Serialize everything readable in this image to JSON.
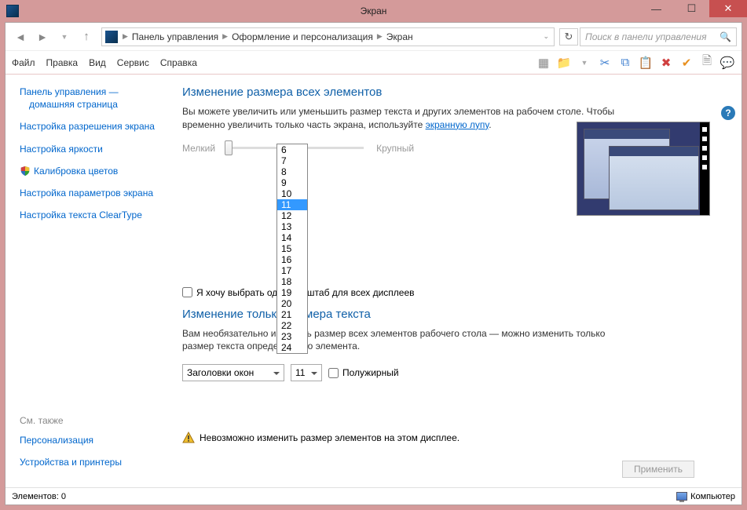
{
  "window": {
    "title": "Экран"
  },
  "breadcrumb": {
    "items": [
      "Панель управления",
      "Оформление и персонализация",
      "Экран"
    ]
  },
  "search": {
    "placeholder": "Поиск в панели управления"
  },
  "menu": {
    "items": [
      "Файл",
      "Правка",
      "Вид",
      "Сервис",
      "Справка"
    ]
  },
  "sidebar": {
    "links": [
      "Панель управления — домашняя страница",
      "Настройка разрешения экрана",
      "Настройка яркости",
      "Калибровка цветов",
      "Настройка параметров экрана",
      "Настройка текста ClearType"
    ],
    "see_also_heading": "См. также",
    "see_also": [
      "Персонализация",
      "Устройства и принтеры"
    ]
  },
  "main": {
    "heading1": "Изменение размера всех элементов",
    "desc1a": "Вы можете увеличить или уменьшить размер текста и других элементов на рабочем столе. Чтобы временно увеличить только часть экрана, используйте ",
    "desc1_link": "экранную лупу",
    "desc1b": ".",
    "slider_min": "Мелкий",
    "slider_max": "Крупный",
    "checkbox_label": "Я хочу выбрать один масштаб для всех дисплеев",
    "heading2": "Изменение только размера текста",
    "desc2": "Вам необязательно изменять размер всех элементов рабочего стола — можно изменить только размер текста определенного элемента.",
    "combo_element": "Заголовки окон",
    "combo_size_value": "11",
    "size_options": [
      "6",
      "7",
      "8",
      "9",
      "10",
      "11",
      "12",
      "13",
      "14",
      "15",
      "16",
      "17",
      "18",
      "19",
      "20",
      "21",
      "22",
      "23",
      "24"
    ],
    "bold_label": "Полужирный",
    "warning": "Невозможно изменить размер элементов на этом дисплее.",
    "apply": "Применить"
  },
  "status": {
    "left": "Элементов: 0",
    "right": "Компьютер"
  }
}
